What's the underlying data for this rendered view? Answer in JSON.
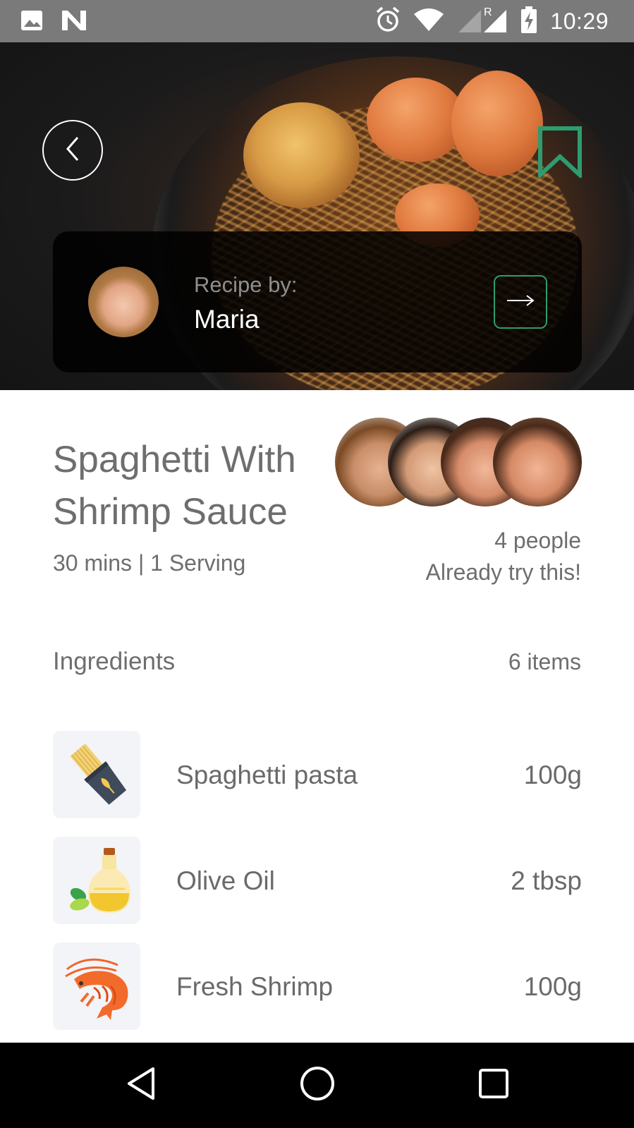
{
  "status_bar": {
    "time": "10:29"
  },
  "hero": {
    "image": "spaghetti-shrimp-photo"
  },
  "author": {
    "label": "Recipe by:",
    "name": "Maria"
  },
  "recipe": {
    "title_line1": "Spaghetti With",
    "title_line2": "Shrimp Sauce",
    "meta": "30 mins | 1 Serving"
  },
  "social": {
    "count_text": "4 people",
    "note": "Already try this!"
  },
  "ingredients": {
    "heading": "Ingredients",
    "count": "6 items",
    "items": [
      {
        "name": "Spaghetti pasta",
        "amount": "100g",
        "icon": "pasta-icon"
      },
      {
        "name": "Olive Oil",
        "amount": "2 tbsp",
        "icon": "olive-oil-icon"
      },
      {
        "name": "Fresh Shrimp",
        "amount": "100g",
        "icon": "shrimp-icon"
      }
    ]
  },
  "colors": {
    "accent": "#2e9c6f",
    "text": "#6e6e6e",
    "icon_bg": "#f3f4f8"
  }
}
